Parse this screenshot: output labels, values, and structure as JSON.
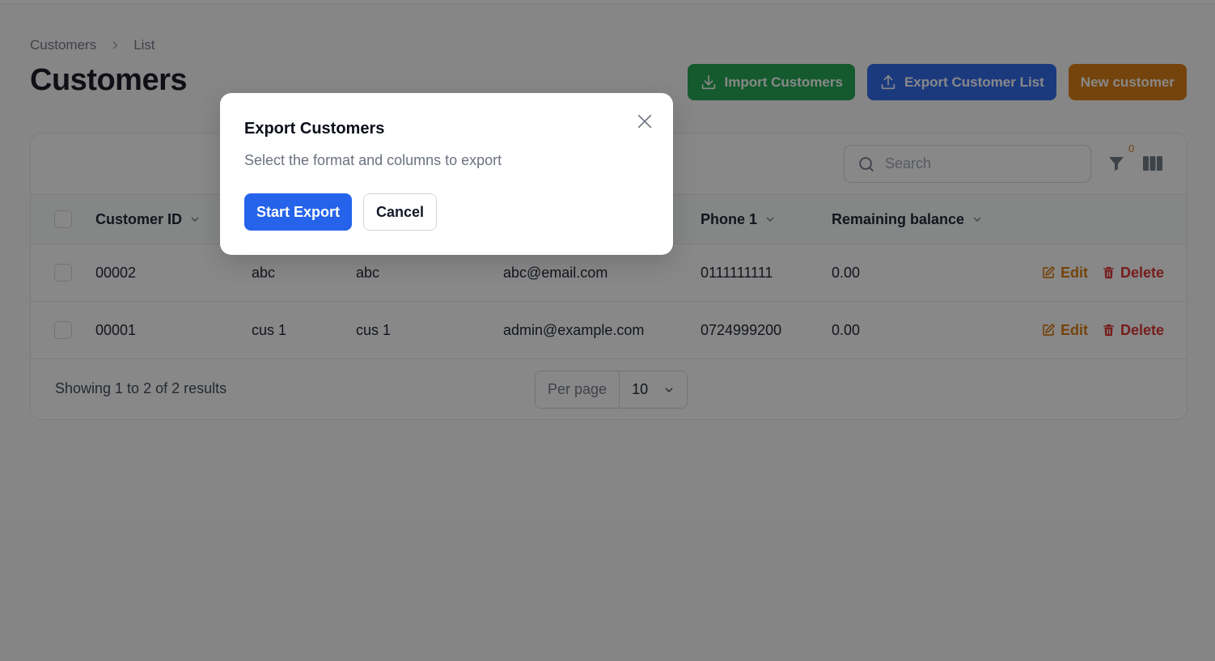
{
  "breadcrumb": {
    "items": [
      "Customers",
      "List"
    ]
  },
  "page": {
    "title": "Customers"
  },
  "header_actions": {
    "import_label": "Import Customers",
    "export_label": "Export Customer List",
    "new_label": "New customer"
  },
  "toolbar": {
    "search_placeholder": "Search",
    "filter_count": "0"
  },
  "table": {
    "columns": [
      "Customer ID",
      "Phone 1",
      "Remaining balance"
    ],
    "rows": [
      {
        "id": "00002",
        "col2": "abc",
        "col3": "abc",
        "email": "abc@email.com",
        "phone": "0111111111",
        "balance": "0.00"
      },
      {
        "id": "00001",
        "col2": "cus 1",
        "col3": "cus 1",
        "email": "admin@example.com",
        "phone": "0724999200",
        "balance": "0.00"
      }
    ],
    "edit_label": "Edit",
    "delete_label": "Delete"
  },
  "footer": {
    "results_text": "Showing 1 to 2 of 2 results",
    "per_page_label": "Per page",
    "per_page_value": "10"
  },
  "modal": {
    "title": "Export Customers",
    "description": "Select the format and columns to export",
    "start_label": "Start Export",
    "cancel_label": "Cancel"
  },
  "colors": {
    "import": "#16a34a",
    "export": "#2563eb",
    "new": "#d97706",
    "edit": "#d97706",
    "delete": "#dc2626"
  }
}
